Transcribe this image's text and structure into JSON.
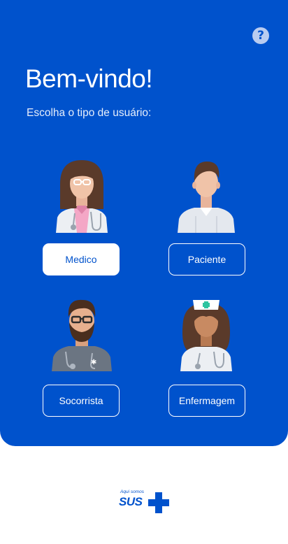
{
  "header": {
    "title": "Bem-vindo!",
    "subtitle": "Escolha o tipo de usuário:",
    "help_icon": "question-circle-icon"
  },
  "roles": [
    {
      "label": "Medico",
      "selected": true,
      "icon": "doctor-avatar-icon"
    },
    {
      "label": "Paciente",
      "selected": false,
      "icon": "patient-avatar-icon"
    },
    {
      "label": "Socorrista",
      "selected": false,
      "icon": "paramedic-avatar-icon"
    },
    {
      "label": "Enfermagem",
      "selected": false,
      "icon": "nurse-avatar-icon"
    }
  ],
  "footer": {
    "logo_tagline": "Aqui somos",
    "logo_text": "SUS"
  },
  "colors": {
    "primary": "#0052CC",
    "white": "#FFFFFF",
    "help": "#B9CCF0"
  }
}
